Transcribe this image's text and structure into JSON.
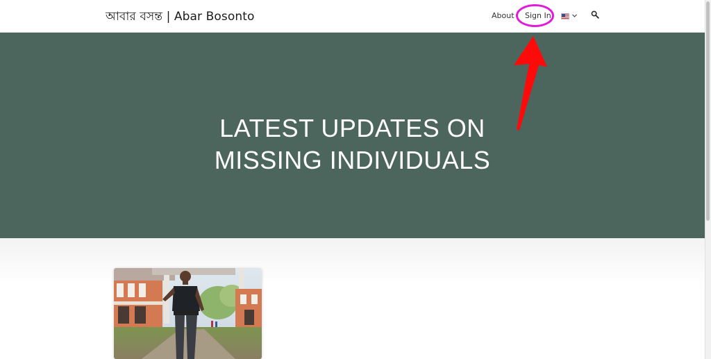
{
  "header": {
    "site_title": "আবার বসন্ত | Abar Bosonto",
    "nav": {
      "about": "About",
      "sign_in": "Sign In"
    },
    "language_flag": "us-flag-icon",
    "search_icon": "search-icon"
  },
  "hero": {
    "title_line1": "LATEST UPDATES ON",
    "title_line2": "MISSING INDIVIDUALS",
    "background_color": "#4c665e"
  },
  "posts": [
    {
      "image": "photo-of-man-outdoors"
    }
  ],
  "annotation": {
    "highlight_color": "#e11bd8",
    "arrow_color": "#ff0a0a"
  }
}
